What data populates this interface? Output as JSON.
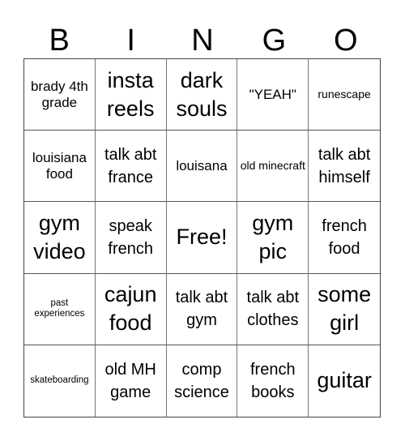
{
  "header": [
    "B",
    "I",
    "N",
    "G",
    "O"
  ],
  "cells": [
    {
      "text": "brady 4th grade",
      "size": "s-m"
    },
    {
      "text": "insta reels",
      "size": "s-xl"
    },
    {
      "text": "dark souls",
      "size": "s-xl"
    },
    {
      "text": "\"YEAH\"",
      "size": "s-m"
    },
    {
      "text": "runescape",
      "size": "s-s"
    },
    {
      "text": "louisiana food",
      "size": "s-m"
    },
    {
      "text": "talk abt france",
      "size": "s-l"
    },
    {
      "text": "louisana",
      "size": "s-m"
    },
    {
      "text": "old minecraft",
      "size": "s-s"
    },
    {
      "text": "talk abt himself",
      "size": "s-l"
    },
    {
      "text": "gym video",
      "size": "s-xl"
    },
    {
      "text": "speak french",
      "size": "s-l"
    },
    {
      "text": "Free!",
      "size": "s-xl"
    },
    {
      "text": "gym pic",
      "size": "s-xl"
    },
    {
      "text": "french food",
      "size": "s-l"
    },
    {
      "text": "past experiences",
      "size": "s-xs"
    },
    {
      "text": "cajun food",
      "size": "s-xl"
    },
    {
      "text": "talk abt gym",
      "size": "s-l"
    },
    {
      "text": "talk abt clothes",
      "size": "s-l"
    },
    {
      "text": "some girl",
      "size": "s-xl"
    },
    {
      "text": "skateboarding",
      "size": "s-xs"
    },
    {
      "text": "old MH game",
      "size": "s-l"
    },
    {
      "text": "comp science",
      "size": "s-l"
    },
    {
      "text": "french books",
      "size": "s-l"
    },
    {
      "text": "guitar",
      "size": "s-xl"
    }
  ]
}
